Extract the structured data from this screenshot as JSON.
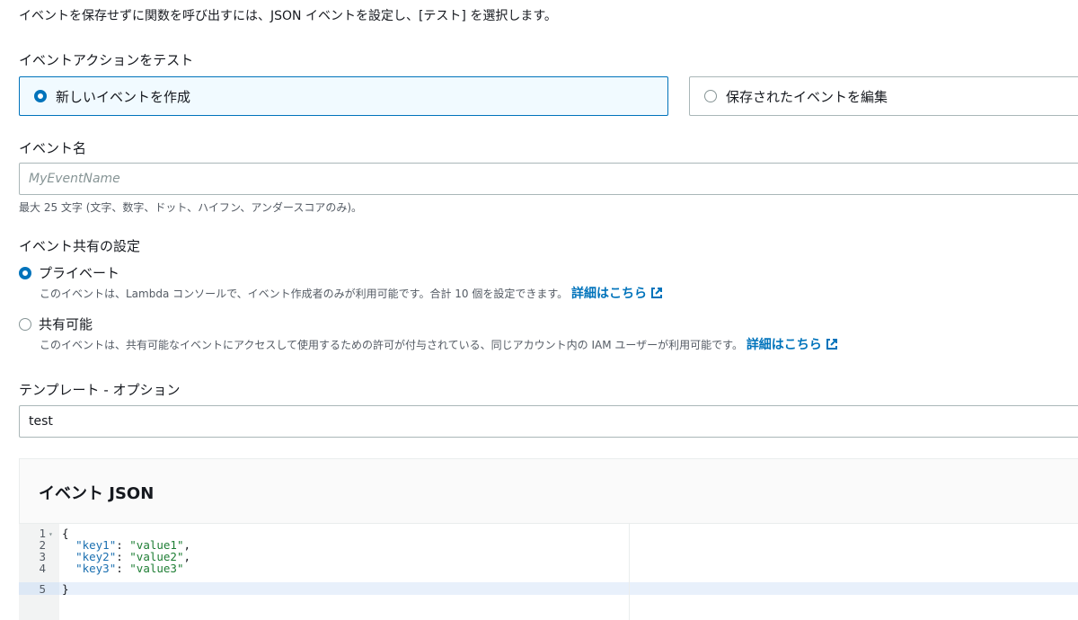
{
  "intro_text": "イベントを保存せずに関数を呼び出すには、JSON イベントを設定し、[テスト] を選択します。",
  "test_action": {
    "label": "イベントアクションをテスト",
    "options": [
      {
        "label": "新しいイベントを作成",
        "selected": true
      },
      {
        "label": "保存されたイベントを編集",
        "selected": false
      }
    ]
  },
  "event_name": {
    "label": "イベント名",
    "placeholder": "MyEventName",
    "value": "",
    "hint": "最大 25 文字 (文字、数字、ドット、ハイフン、アンダースコアのみ)。"
  },
  "sharing": {
    "label": "イベント共有の設定",
    "options": [
      {
        "label": "プライベート",
        "selected": true,
        "description": "このイベントは、Lambda コンソールで、イベント作成者のみが利用可能です。合計 10 個を設定できます。",
        "link": "詳細はこちら"
      },
      {
        "label": "共有可能",
        "selected": false,
        "description": "このイベントは、共有可能なイベントにアクセスして使用するための許可が付与されている、同じアカウント内の IAM ユーザーが利用可能です。",
        "link": "詳細はこちら"
      }
    ]
  },
  "template": {
    "label": "テンプレート - オプション",
    "value": "test"
  },
  "event_json": {
    "title": "イベント JSON",
    "line_numbers": [
      "1",
      "2",
      "3",
      "4",
      "5"
    ],
    "lines": [
      {
        "open": "{"
      },
      {
        "key": "\"key1\"",
        "sep": ": ",
        "val": "\"value1\"",
        "end": ","
      },
      {
        "key": "\"key2\"",
        "sep": ": ",
        "val": "\"value2\"",
        "end": ","
      },
      {
        "key": "\"key3\"",
        "sep": ": ",
        "val": "\"value3\"",
        "end": ""
      },
      {
        "close": "}"
      }
    ]
  },
  "colors": {
    "accent": "#0073bb",
    "selected_tile_bg": "#f1faff",
    "json_key": "#1a6fb0",
    "json_string": "#1e7e34"
  }
}
